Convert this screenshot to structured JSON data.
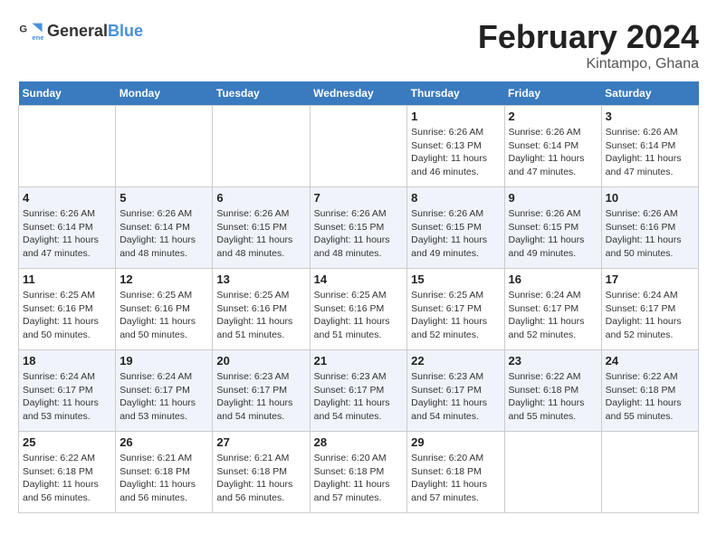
{
  "header": {
    "logo_general": "General",
    "logo_blue": "Blue",
    "month": "February 2024",
    "location": "Kintampo, Ghana"
  },
  "days_of_week": [
    "Sunday",
    "Monday",
    "Tuesday",
    "Wednesday",
    "Thursday",
    "Friday",
    "Saturday"
  ],
  "weeks": [
    [
      {
        "day": "",
        "info": ""
      },
      {
        "day": "",
        "info": ""
      },
      {
        "day": "",
        "info": ""
      },
      {
        "day": "",
        "info": ""
      },
      {
        "day": "1",
        "info": "Sunrise: 6:26 AM\nSunset: 6:13 PM\nDaylight: 11 hours\nand 46 minutes."
      },
      {
        "day": "2",
        "info": "Sunrise: 6:26 AM\nSunset: 6:14 PM\nDaylight: 11 hours\nand 47 minutes."
      },
      {
        "day": "3",
        "info": "Sunrise: 6:26 AM\nSunset: 6:14 PM\nDaylight: 11 hours\nand 47 minutes."
      }
    ],
    [
      {
        "day": "4",
        "info": "Sunrise: 6:26 AM\nSunset: 6:14 PM\nDaylight: 11 hours\nand 47 minutes."
      },
      {
        "day": "5",
        "info": "Sunrise: 6:26 AM\nSunset: 6:14 PM\nDaylight: 11 hours\nand 48 minutes."
      },
      {
        "day": "6",
        "info": "Sunrise: 6:26 AM\nSunset: 6:15 PM\nDaylight: 11 hours\nand 48 minutes."
      },
      {
        "day": "7",
        "info": "Sunrise: 6:26 AM\nSunset: 6:15 PM\nDaylight: 11 hours\nand 48 minutes."
      },
      {
        "day": "8",
        "info": "Sunrise: 6:26 AM\nSunset: 6:15 PM\nDaylight: 11 hours\nand 49 minutes."
      },
      {
        "day": "9",
        "info": "Sunrise: 6:26 AM\nSunset: 6:15 PM\nDaylight: 11 hours\nand 49 minutes."
      },
      {
        "day": "10",
        "info": "Sunrise: 6:26 AM\nSunset: 6:16 PM\nDaylight: 11 hours\nand 50 minutes."
      }
    ],
    [
      {
        "day": "11",
        "info": "Sunrise: 6:25 AM\nSunset: 6:16 PM\nDaylight: 11 hours\nand 50 minutes."
      },
      {
        "day": "12",
        "info": "Sunrise: 6:25 AM\nSunset: 6:16 PM\nDaylight: 11 hours\nand 50 minutes."
      },
      {
        "day": "13",
        "info": "Sunrise: 6:25 AM\nSunset: 6:16 PM\nDaylight: 11 hours\nand 51 minutes."
      },
      {
        "day": "14",
        "info": "Sunrise: 6:25 AM\nSunset: 6:16 PM\nDaylight: 11 hours\nand 51 minutes."
      },
      {
        "day": "15",
        "info": "Sunrise: 6:25 AM\nSunset: 6:17 PM\nDaylight: 11 hours\nand 52 minutes."
      },
      {
        "day": "16",
        "info": "Sunrise: 6:24 AM\nSunset: 6:17 PM\nDaylight: 11 hours\nand 52 minutes."
      },
      {
        "day": "17",
        "info": "Sunrise: 6:24 AM\nSunset: 6:17 PM\nDaylight: 11 hours\nand 52 minutes."
      }
    ],
    [
      {
        "day": "18",
        "info": "Sunrise: 6:24 AM\nSunset: 6:17 PM\nDaylight: 11 hours\nand 53 minutes."
      },
      {
        "day": "19",
        "info": "Sunrise: 6:24 AM\nSunset: 6:17 PM\nDaylight: 11 hours\nand 53 minutes."
      },
      {
        "day": "20",
        "info": "Sunrise: 6:23 AM\nSunset: 6:17 PM\nDaylight: 11 hours\nand 54 minutes."
      },
      {
        "day": "21",
        "info": "Sunrise: 6:23 AM\nSunset: 6:17 PM\nDaylight: 11 hours\nand 54 minutes."
      },
      {
        "day": "22",
        "info": "Sunrise: 6:23 AM\nSunset: 6:17 PM\nDaylight: 11 hours\nand 54 minutes."
      },
      {
        "day": "23",
        "info": "Sunrise: 6:22 AM\nSunset: 6:18 PM\nDaylight: 11 hours\nand 55 minutes."
      },
      {
        "day": "24",
        "info": "Sunrise: 6:22 AM\nSunset: 6:18 PM\nDaylight: 11 hours\nand 55 minutes."
      }
    ],
    [
      {
        "day": "25",
        "info": "Sunrise: 6:22 AM\nSunset: 6:18 PM\nDaylight: 11 hours\nand 56 minutes."
      },
      {
        "day": "26",
        "info": "Sunrise: 6:21 AM\nSunset: 6:18 PM\nDaylight: 11 hours\nand 56 minutes."
      },
      {
        "day": "27",
        "info": "Sunrise: 6:21 AM\nSunset: 6:18 PM\nDaylight: 11 hours\nand 56 minutes."
      },
      {
        "day": "28",
        "info": "Sunrise: 6:20 AM\nSunset: 6:18 PM\nDaylight: 11 hours\nand 57 minutes."
      },
      {
        "day": "29",
        "info": "Sunrise: 6:20 AM\nSunset: 6:18 PM\nDaylight: 11 hours\nand 57 minutes."
      },
      {
        "day": "",
        "info": ""
      },
      {
        "day": "",
        "info": ""
      }
    ]
  ]
}
